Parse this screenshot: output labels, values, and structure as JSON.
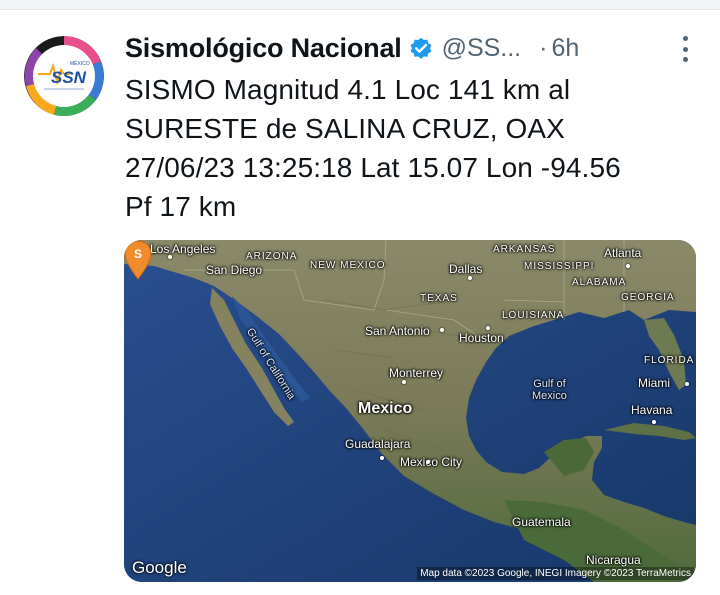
{
  "account": {
    "display_name": "Sismológico Nacional",
    "handle": "@SS...",
    "separator": "·",
    "time_ago": "6h",
    "avatar": {
      "brand": "SSN",
      "small_text": "MÉXICO",
      "ring_colors": [
        "#e94f8a",
        "#f7a81b",
        "#3cae5a",
        "#3a7bd5",
        "#8e44ad",
        "#1a1a1a"
      ]
    },
    "verified_color": "#1d9bf0"
  },
  "tweet": {
    "lines": [
      "SISMO Magnitud 4.1 Loc  141 km al",
      "SURESTE de SALINA CRUZ, OAX",
      "27/06/23 13:25:18 Lat 15.07 Lon -94.56",
      "Pf 17 km"
    ]
  },
  "map": {
    "labels": {
      "los_angeles": "Los Angeles",
      "arizona": "ARIZONA",
      "san_diego": "San Diego",
      "new_mexico": "NEW MEXICO",
      "arkansas": "ARKANSAS",
      "atlanta": "Atlanta",
      "dallas": "Dallas",
      "mississippi": "MISSISSIPPI",
      "alabama": "ALABAMA",
      "texas": "TEXAS",
      "georgia": "GEORGIA",
      "louisiana": "LOUISIANA",
      "san_antonio": "San Antonio",
      "houston": "Houston",
      "florida": "FLORIDA",
      "gulf_of_california": "Gulf of California",
      "monterrey": "Monterrey",
      "gulf_of_mexico_1": "Gulf of",
      "gulf_of_mexico_2": "Mexico",
      "miami": "Miami",
      "mexico": "Mexico",
      "havana": "Havana",
      "guadalajara": "Guadalajara",
      "mexico_city": "Mexico City",
      "guatemala": "Guatemala",
      "nicaragua": "Nicaragua"
    },
    "pin_letter": "S",
    "pin_color": "#f08b2c",
    "google": "Google",
    "attribution": "Map data ©2023 Google, INEGI Imagery ©2023 TerraMetrics"
  }
}
